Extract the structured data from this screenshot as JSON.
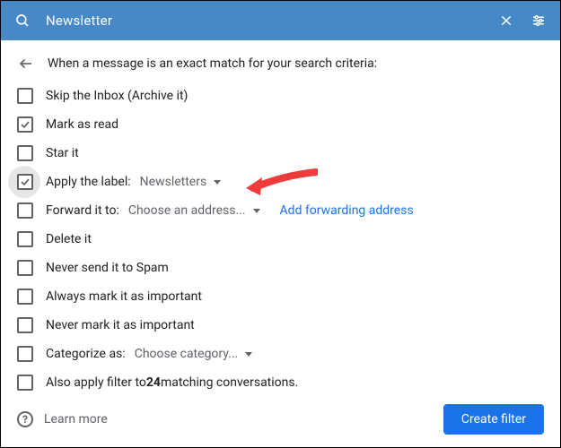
{
  "topbar": {
    "title": "Newsletter"
  },
  "header": {
    "text": "When a message is an exact match for your search criteria:"
  },
  "options": {
    "skip_inbox": "Skip the Inbox (Archive it)",
    "mark_read": "Mark as read",
    "star_it": "Star it",
    "apply_label_prefix": "Apply the label:",
    "apply_label_value": "Newsletters",
    "forward_prefix": "Forward it to:",
    "forward_value": "Choose an address...",
    "forward_link": "Add forwarding address",
    "delete_it": "Delete it",
    "never_spam": "Never send it to Spam",
    "always_important": "Always mark it as important",
    "never_important": "Never mark it as important",
    "categorize_prefix": "Categorize as:",
    "categorize_value": "Choose category...",
    "also_apply_prefix": "Also apply filter to ",
    "also_apply_count": "24",
    "also_apply_suffix": " matching conversations."
  },
  "footer": {
    "learn_more": "Learn more",
    "create": "Create filter"
  }
}
